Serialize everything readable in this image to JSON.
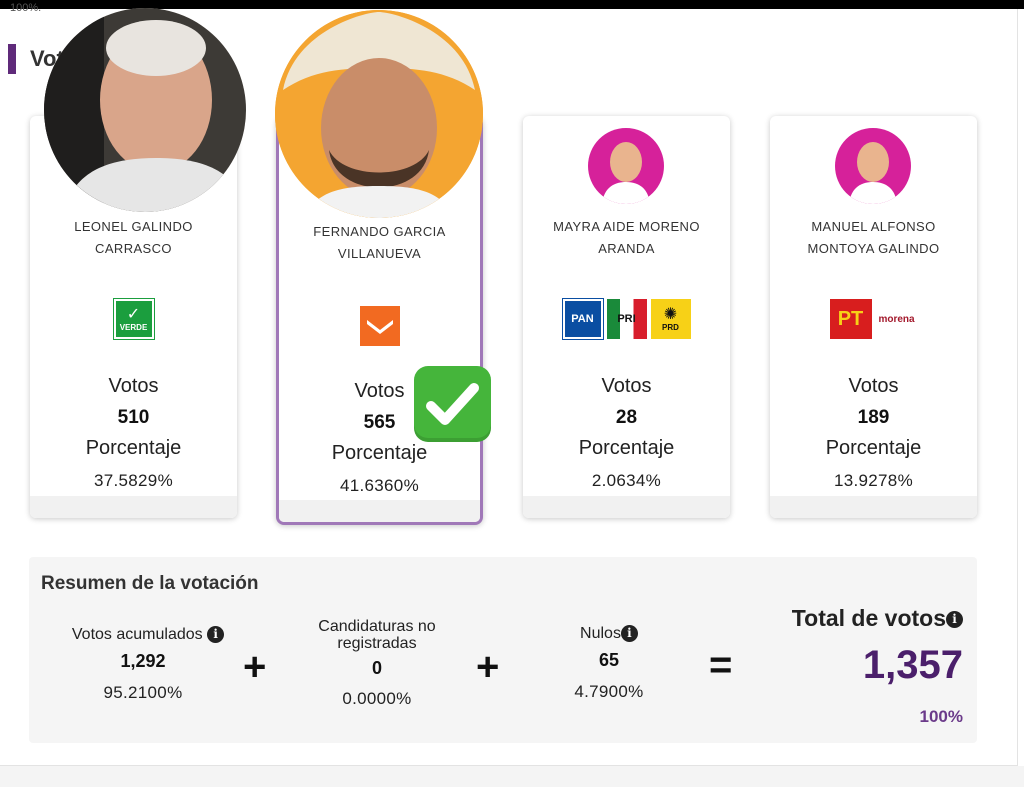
{
  "header": {
    "clipped_top_text": "100%.",
    "section_title": "Votos por Pontal"
  },
  "labels": {
    "votes": "Votos",
    "percentage": "Porcentaje"
  },
  "candidates": [
    {
      "name_line1": "LEONEL GALINDO",
      "name_line2": "CARRASCO",
      "parties": [
        "VERDE"
      ],
      "votes": "510",
      "percentage": "37.5829%",
      "winner": false
    },
    {
      "name_line1": "FERNANDO GARCIA",
      "name_line2": "VILLANUEVA",
      "parties": [
        "MOVIMIENTO CIUDADANO"
      ],
      "votes": "565",
      "percentage": "41.6360%",
      "winner": true
    },
    {
      "name_line1": "MAYRA AIDE MORENO",
      "name_line2": "ARANDA",
      "parties": [
        "PAN",
        "PRI",
        "PRD"
      ],
      "votes": "28",
      "percentage": "2.0634%",
      "winner": false
    },
    {
      "name_line1": "MANUEL ALFONSO",
      "name_line2": "MONTOYA GALINDO",
      "parties": [
        "PT",
        "morena"
      ],
      "votes": "189",
      "percentage": "13.9278%",
      "winner": false
    }
  ],
  "party_logo_text": {
    "verde": "VERDE",
    "pan": "PAN",
    "pri": "PRI",
    "prd": "PRD",
    "pt": "PT",
    "morena": "morena"
  },
  "summary": {
    "title": "Resumen de la votación",
    "accumulated_label": "Votos acumulados",
    "accumulated_value": "1,292",
    "accumulated_pct": "95.2100%",
    "unregistered_label_line1": "Candidaturas no",
    "unregistered_label_line2": "registradas",
    "unregistered_value": "0",
    "unregistered_pct": "0.0000%",
    "null_label": "Nulos",
    "null_value": "65",
    "null_pct": "4.7900%",
    "total_label": "Total de votos",
    "total_value": "1,357",
    "total_pct": "100%",
    "plus_symbol": "+",
    "equals_symbol": "="
  },
  "colors": {
    "accent_purple": "#5f2a7a",
    "winner_border": "#a078b8",
    "total_value": "#4b1f6b",
    "avatar_pink": "#d6219a",
    "check_green": "#45b53b"
  },
  "icons": {
    "winner_mark": "check-mark-icon",
    "info": "info-icon"
  }
}
